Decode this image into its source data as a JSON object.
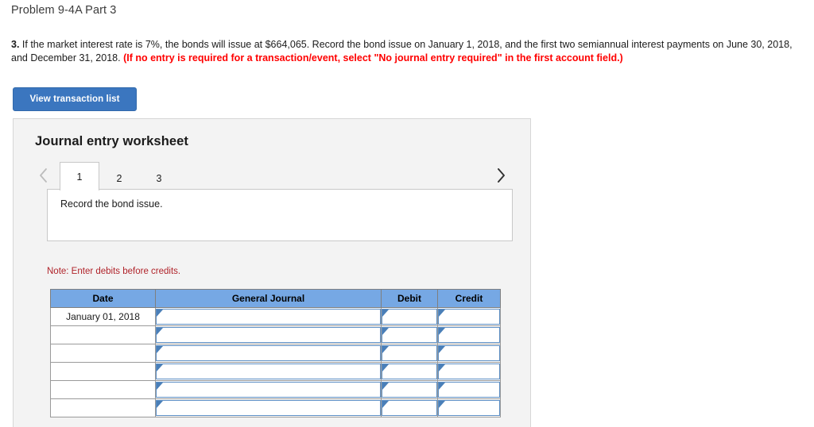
{
  "page": {
    "title": "Problem 9-4A Part 3"
  },
  "question": {
    "number": "3.",
    "body": " If the market interest rate is 7%, the bonds will issue at $664,065. Record the bond issue on January 1, 2018, and the first two semiannual interest payments on June 30, 2018, and December 31, 2018. ",
    "emphasis": "(If no entry is required for a transaction/event, select \"No journal entry required\" in the first account field.)"
  },
  "toolbar": {
    "view_transaction_list_label": "View transaction list"
  },
  "worksheet": {
    "heading": "Journal entry worksheet",
    "prev_icon": "chevron-left-icon",
    "next_icon": "chevron-right-icon",
    "tabs": [
      {
        "label": "1",
        "active": true
      },
      {
        "label": "2",
        "active": false
      },
      {
        "label": "3",
        "active": false
      }
    ],
    "description": "Record the bond issue.",
    "note": "Note: Enter debits before credits.",
    "table": {
      "headers": [
        "Date",
        "General Journal",
        "Debit",
        "Credit"
      ],
      "rows": [
        {
          "date": "January 01, 2018",
          "general_journal": "",
          "debit": "",
          "credit": ""
        },
        {
          "date": "",
          "general_journal": "",
          "debit": "",
          "credit": ""
        },
        {
          "date": "",
          "general_journal": "",
          "debit": "",
          "credit": ""
        },
        {
          "date": "",
          "general_journal": "",
          "debit": "",
          "credit": ""
        },
        {
          "date": "",
          "general_journal": "",
          "debit": "",
          "credit": ""
        },
        {
          "date": "",
          "general_journal": "",
          "debit": "",
          "credit": ""
        }
      ]
    }
  },
  "colors": {
    "button_blue": "#3b76bf",
    "table_header_blue": "#76a8e4",
    "note_red": "#b0232a",
    "emphasis_red": "#ff0000",
    "panel_background": "#f3f3f3"
  }
}
